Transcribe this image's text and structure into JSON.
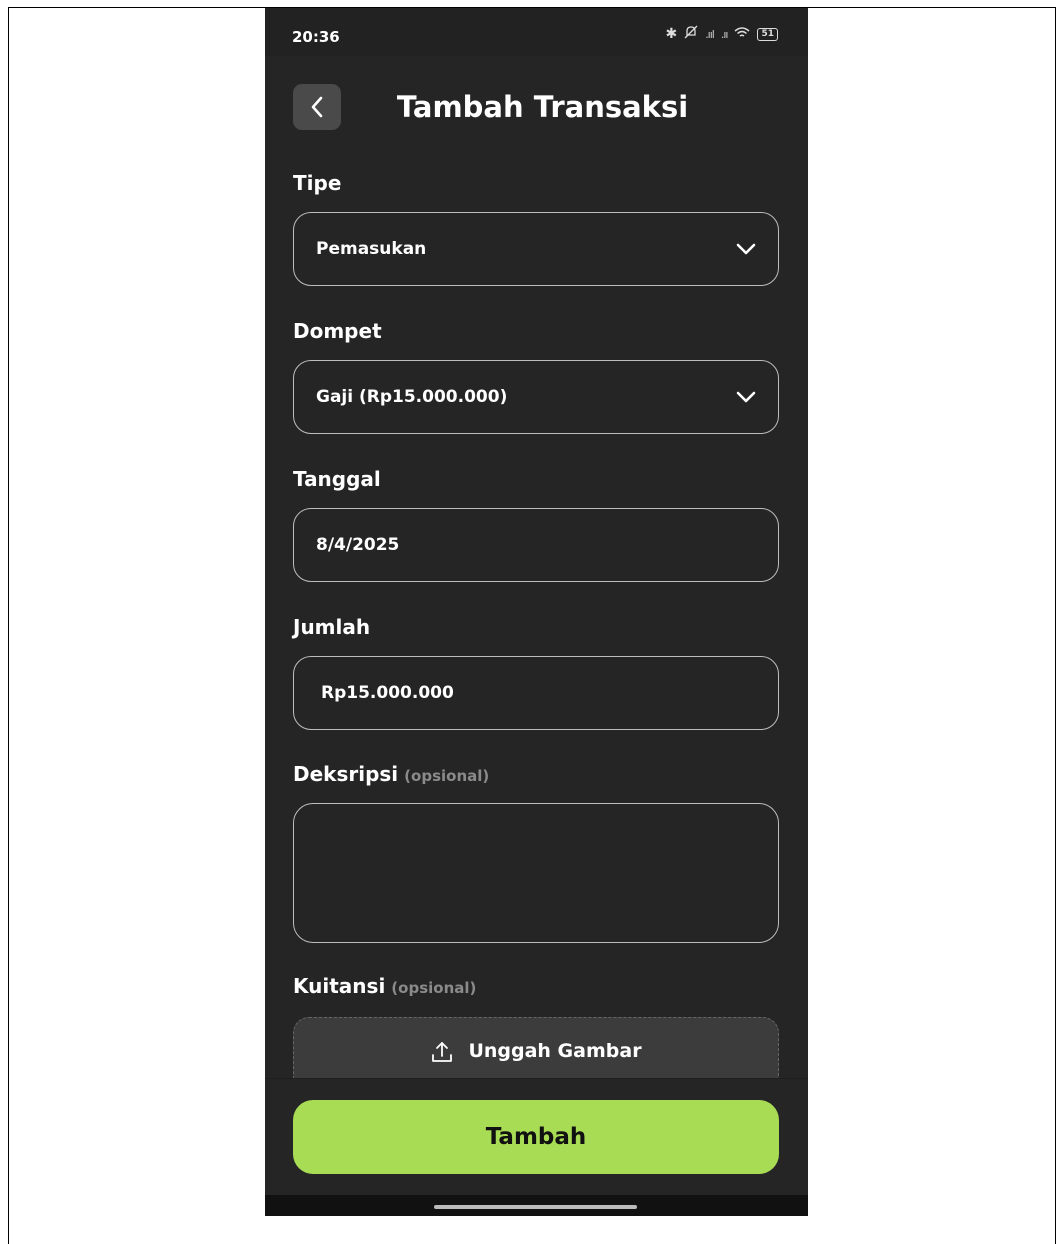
{
  "status_bar": {
    "time": "20:36",
    "battery": "51"
  },
  "header": {
    "title": "Tambah Transaksi"
  },
  "form": {
    "tipe": {
      "label": "Tipe",
      "value": "Pemasukan"
    },
    "dompet": {
      "label": "Dompet",
      "value": "Gaji (Rp15.000.000)"
    },
    "tanggal": {
      "label": "Tanggal",
      "value": "8/4/2025"
    },
    "jumlah": {
      "label": "Jumlah",
      "value": "Rp15.000.000"
    },
    "deskripsi": {
      "label": "Deksripsi",
      "optional": "(opsional)",
      "value": ""
    },
    "kuitansi": {
      "label": "Kuitansi",
      "optional": "(opsional)",
      "upload_label": "Unggah Gambar"
    }
  },
  "submit": {
    "label": "Tambah"
  },
  "colors": {
    "background": "#252525",
    "accent": "#a9dc55",
    "field_border": "#bdbdbd"
  }
}
